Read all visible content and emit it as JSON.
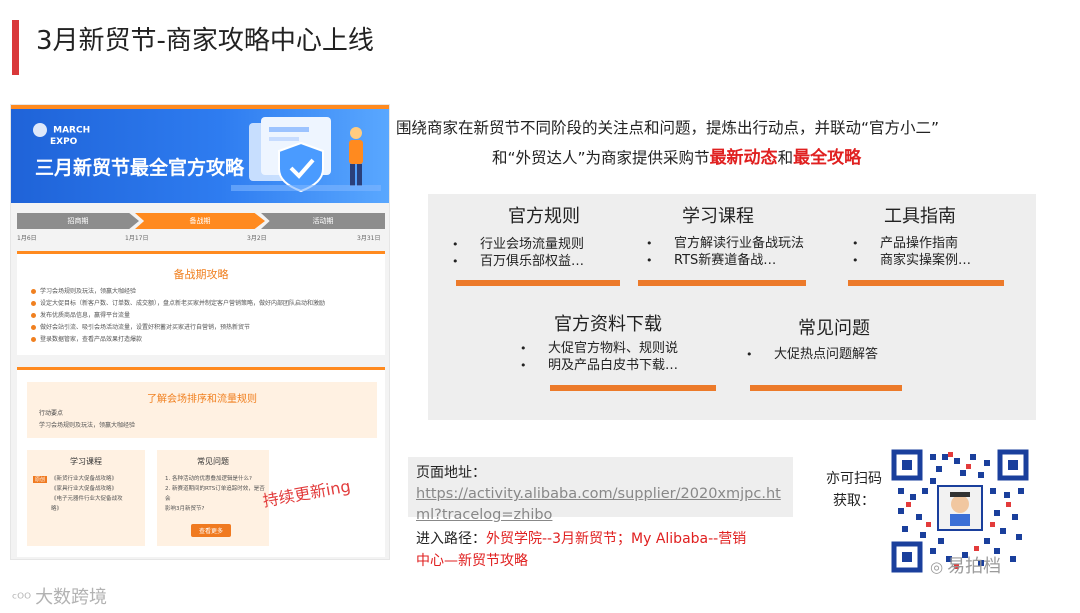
{
  "slide": {
    "title": "3月新贸节-商家攻略中心上线"
  },
  "screenshot": {
    "banner_logo_line1": "MARCH",
    "banner_logo_line2": "EXPO",
    "banner_title": "三月新贸节最全官方攻略",
    "timeline_phases": [
      "招商期",
      "备战期",
      "活动期"
    ],
    "timeline_dates": [
      "1月6日",
      "1月17日",
      "3月2日",
      "3月31日"
    ],
    "card1_title": "备战期攻略",
    "card1_lines": [
      "学习会场规则及玩法，领赢大咖经验",
      "设定大促目标（新客户数、订单数、成交额），盘点新老买家并制定客户营销策略，做好内部团队启动和激励",
      "发布优质商品信息，赢得平台流量",
      "做好会站引流、吸引会场活动流量，设置好积蓄对买家进行自营销，预热新贸节",
      "登录数据管家，查看产品效果打造爆款"
    ],
    "card2_title": "了解会场排序和流量规则",
    "card2_sub": "行动要点",
    "card2_sub2": "学习会场规则及玩法，领赢大咖经验",
    "mini1_title": "学习课程",
    "mini1_badge": "原创",
    "mini1_lines": [
      "《新货行业大促备战攻略》",
      "《家具行业大促备战攻略》",
      "《电子元器件行业大促备战攻",
      "略》"
    ],
    "mini2_title": "常见问题",
    "mini2_lines": [
      "1. 各种活动的优惠叠加逻辑是什么?",
      "2. 新赛道期间的RTS订单追踪时效，是否会",
      "影响3月新贸节?"
    ],
    "mini2_button": "查看更多",
    "overlay_text": "持续更新ing"
  },
  "description": {
    "line1": "围绕商家在新贸节不同阶段的关注点和问题，提炼出行动点，并联动“官方小二”",
    "line2_prefix": "和“外贸达人”为商家提供采购节",
    "line2_highlight1": "最新动态",
    "line2_mid": "和",
    "line2_highlight2": "最全攻略"
  },
  "sections": [
    {
      "title": "官方规则",
      "items": [
        "行业会场流量规则",
        "百万俱乐部权益…"
      ]
    },
    {
      "title": "学习课程",
      "items": [
        "官方解读行业备战玩法",
        "RTS新赛道备战…"
      ]
    },
    {
      "title": "工具指南",
      "items": [
        "产品操作指南",
        "商家实操案例…"
      ]
    },
    {
      "title": "官方资料下载",
      "items": [
        "大促官方物料、规则说",
        "明及产品白皮书下载…"
      ]
    },
    {
      "title": "常见问题",
      "items": [
        "大促热点问题解答"
      ]
    }
  ],
  "info": {
    "page_label": "页面地址：",
    "url": "https://activity.alibaba.com/supplier/2020xmjpc.html?tracelog=zhibo",
    "path_label": "进入路径：",
    "path_value_line1": "外贸学院--3月新贸节；My Alibaba--营销",
    "path_value_line2": "中心—新贸节攻略",
    "qr_caption_line1": "亦可扫码",
    "qr_caption_line2": "获取："
  },
  "watermarks": {
    "left": "大数跨境",
    "right": "易拍档"
  },
  "colors": {
    "accent_red": "#d9383a",
    "highlight_red": "#e02020",
    "orange_bar": "#ec7a2a",
    "panel_gray": "#eeeeee",
    "banner_blue": "#2e7cf0"
  }
}
